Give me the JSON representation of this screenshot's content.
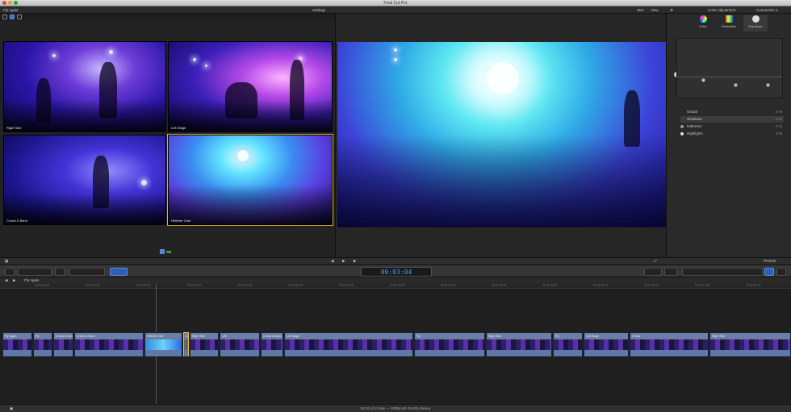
{
  "window": {
    "title": "Final Cut Pro"
  },
  "viewer_bar": {
    "event_name": "Fly Again",
    "settings_label": "Settings",
    "zoom": "36%",
    "view_label": "View"
  },
  "inspector_bar": {
    "title": "Color Adjustment",
    "connection": "Connection 1"
  },
  "angles": [
    {
      "label": "Right Side"
    },
    {
      "label": "Left Stage"
    },
    {
      "label": "Crowd & Band"
    },
    {
      "label": "Hellcher Cam"
    }
  ],
  "inspector": {
    "tabs": [
      {
        "label": "Color"
      },
      {
        "label": "Saturation"
      },
      {
        "label": "Exposure"
      }
    ],
    "rows": [
      {
        "label": "Global",
        "value": "0 %"
      },
      {
        "label": "Shadows",
        "value": "0 %"
      },
      {
        "label": "Midtones",
        "value": "0 %"
      },
      {
        "label": "Highlights",
        "value": "0 %"
      }
    ],
    "presets_label": "Presets"
  },
  "timecode": "00:03:04",
  "timeline": {
    "project_name": "Fly Again",
    "ruler_ticks": [
      "00:00:00:00",
      "00:00:10:00",
      "00:00:20:00",
      "00:00:30:00",
      "00:00:40:00",
      "00:00:50:00",
      "00:01:00:00",
      "00:01:10:00",
      "00:01:20:00",
      "00:01:30:00",
      "00:01:40:00",
      "00:01:50:00",
      "00:02:00:00",
      "00:02:10:00",
      "00:02:20:00"
    ]
  },
  "clips": [
    {
      "label": "Fly Again"
    },
    {
      "label": "Fly"
    },
    {
      "label": "Crowd & Band"
    },
    {
      "label": "Crowd & Band"
    },
    {
      "label": "Hellcher Cam"
    },
    {
      "label": "Crowd"
    },
    {
      "label": "Right Side"
    },
    {
      "label": "Left"
    },
    {
      "label": "Crowd & Band"
    },
    {
      "label": "Left Stage"
    },
    {
      "label": "Fly"
    },
    {
      "label": "Right Side"
    },
    {
      "label": "Fly"
    },
    {
      "label": "Left Stage"
    },
    {
      "label": "Crowd"
    },
    {
      "label": "Right Side"
    }
  ],
  "status": {
    "text": "03:03 of 3 total — 1080p HD 29.97p Stereo"
  }
}
